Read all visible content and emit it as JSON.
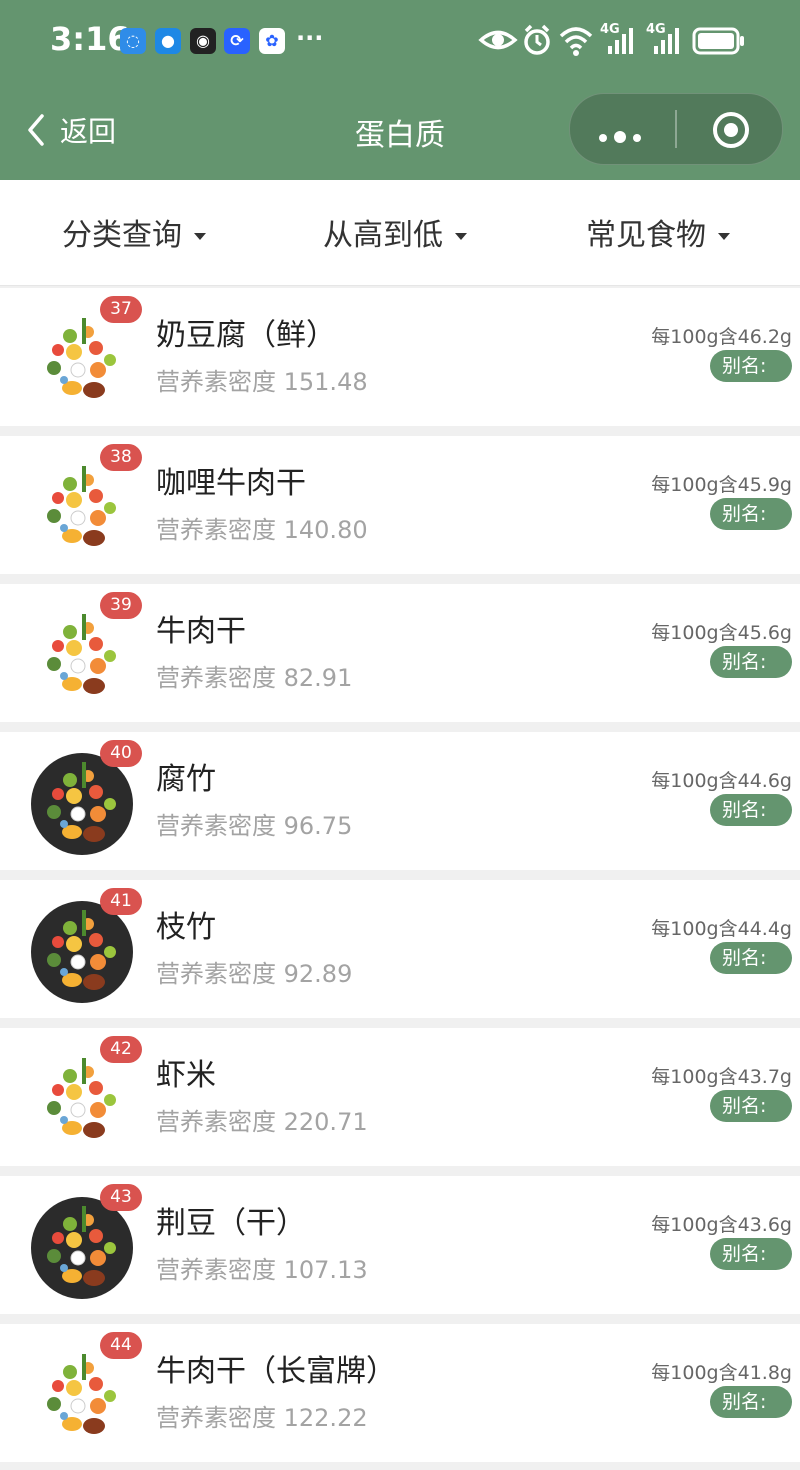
{
  "status_bar": {
    "time": "3:16",
    "app_icons": [
      "messages-icon",
      "chat-bubble-icon",
      "qq-penguin-icon",
      "sync-icon",
      "baidu-paw-icon"
    ],
    "more": "···",
    "network_1": "4G",
    "network_2": "4G"
  },
  "nav": {
    "back_label": "返回",
    "title": "蛋白质"
  },
  "filters": {
    "category": "分类查询",
    "sort": "从高到低",
    "common": "常见食物"
  },
  "colors": {
    "header_green": "#64956f",
    "badge_red": "#d9534f",
    "alias_green": "#64956f"
  },
  "items": [
    {
      "rank": "37",
      "name": "奶豆腐（鲜）",
      "density": "营养素密度 151.48",
      "amount": "每100g含46.2g",
      "alias": "别名:",
      "thumb": "light"
    },
    {
      "rank": "38",
      "name": "咖哩牛肉干",
      "density": "营养素密度 140.80",
      "amount": "每100g含45.9g",
      "alias": "别名:",
      "thumb": "light"
    },
    {
      "rank": "39",
      "name": "牛肉干",
      "density": "营养素密度 82.91",
      "amount": "每100g含45.6g",
      "alias": "别名:",
      "thumb": "light"
    },
    {
      "rank": "40",
      "name": "腐竹",
      "density": "营养素密度 96.75",
      "amount": "每100g含44.6g",
      "alias": "别名:",
      "thumb": "dark"
    },
    {
      "rank": "41",
      "name": "枝竹",
      "density": "营养素密度 92.89",
      "amount": "每100g含44.4g",
      "alias": "别名:",
      "thumb": "dark"
    },
    {
      "rank": "42",
      "name": "虾米",
      "density": "营养素密度 220.71",
      "amount": "每100g含43.7g",
      "alias": "别名:",
      "thumb": "light"
    },
    {
      "rank": "43",
      "name": "荆豆（干）",
      "density": "营养素密度 107.13",
      "amount": "每100g含43.6g",
      "alias": "别名:",
      "thumb": "dark"
    },
    {
      "rank": "44",
      "name": "牛肉干（长富牌）",
      "density": "营养素密度 122.22",
      "amount": "每100g含41.8g",
      "alias": "别名:",
      "thumb": "light"
    }
  ]
}
